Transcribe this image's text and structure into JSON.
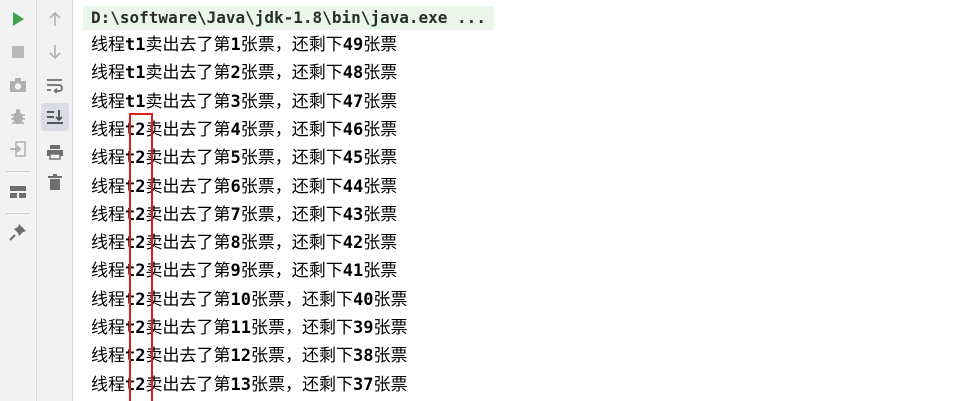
{
  "toolbar": {
    "left": [
      {
        "icon": "run-icon"
      },
      {
        "icon": "stop-icon"
      },
      {
        "icon": "camera-icon"
      },
      {
        "icon": "debug-icon"
      },
      {
        "icon": "exit-icon"
      },
      {
        "icon": "layout-icon"
      },
      {
        "icon": "pin-icon"
      }
    ],
    "right": [
      {
        "icon": "arrow-up-icon"
      },
      {
        "icon": "arrow-down-icon"
      },
      {
        "icon": "soft-wrap-icon"
      },
      {
        "icon": "scroll-to-end-icon"
      },
      {
        "icon": "print-icon"
      },
      {
        "icon": "trash-icon"
      }
    ]
  },
  "console": {
    "command": "D:\\software\\Java\\jdk-1.8\\bin\\java.exe ...",
    "lines": [
      {
        "prefix": "线程",
        "thread": "t1",
        "mid": "卖出去了第",
        "sold": "1",
        "mid2": "张票，还剩下",
        "left": "49",
        "suffix": "张票"
      },
      {
        "prefix": "线程",
        "thread": "t1",
        "mid": "卖出去了第",
        "sold": "2",
        "mid2": "张票，还剩下",
        "left": "48",
        "suffix": "张票"
      },
      {
        "prefix": "线程",
        "thread": "t1",
        "mid": "卖出去了第",
        "sold": "3",
        "mid2": "张票，还剩下",
        "left": "47",
        "suffix": "张票"
      },
      {
        "prefix": "线程",
        "thread": "t2",
        "mid": "卖出去了第",
        "sold": "4",
        "mid2": "张票，还剩下",
        "left": "46",
        "suffix": "张票"
      },
      {
        "prefix": "线程",
        "thread": "t2",
        "mid": "卖出去了第",
        "sold": "5",
        "mid2": "张票，还剩下",
        "left": "45",
        "suffix": "张票"
      },
      {
        "prefix": "线程",
        "thread": "t2",
        "mid": "卖出去了第",
        "sold": "6",
        "mid2": "张票，还剩下",
        "left": "44",
        "suffix": "张票"
      },
      {
        "prefix": "线程",
        "thread": "t2",
        "mid": "卖出去了第",
        "sold": "7",
        "mid2": "张票，还剩下",
        "left": "43",
        "suffix": "张票"
      },
      {
        "prefix": "线程",
        "thread": "t2",
        "mid": "卖出去了第",
        "sold": "8",
        "mid2": "张票，还剩下",
        "left": "42",
        "suffix": "张票"
      },
      {
        "prefix": "线程",
        "thread": "t2",
        "mid": "卖出去了第",
        "sold": "9",
        "mid2": "张票，还剩下",
        "left": "41",
        "suffix": "张票"
      },
      {
        "prefix": "线程",
        "thread": "t2",
        "mid": "卖出去了第",
        "sold": "10",
        "mid2": "张票，还剩下",
        "left": "40",
        "suffix": "张票"
      },
      {
        "prefix": "线程",
        "thread": "t2",
        "mid": "卖出去了第",
        "sold": "11",
        "mid2": "张票，还剩下",
        "left": "39",
        "suffix": "张票"
      },
      {
        "prefix": "线程",
        "thread": "t2",
        "mid": "卖出去了第",
        "sold": "12",
        "mid2": "张票，还剩下",
        "left": "38",
        "suffix": "张票"
      },
      {
        "prefix": "线程",
        "thread": "t2",
        "mid": "卖出去了第",
        "sold": "13",
        "mid2": "张票，还剩下",
        "left": "37",
        "suffix": "张票"
      }
    ]
  },
  "colors": {
    "highlight_box": "#e01d1d",
    "command_bg": "#eaf6ea",
    "run_green": "#3fa34d"
  }
}
